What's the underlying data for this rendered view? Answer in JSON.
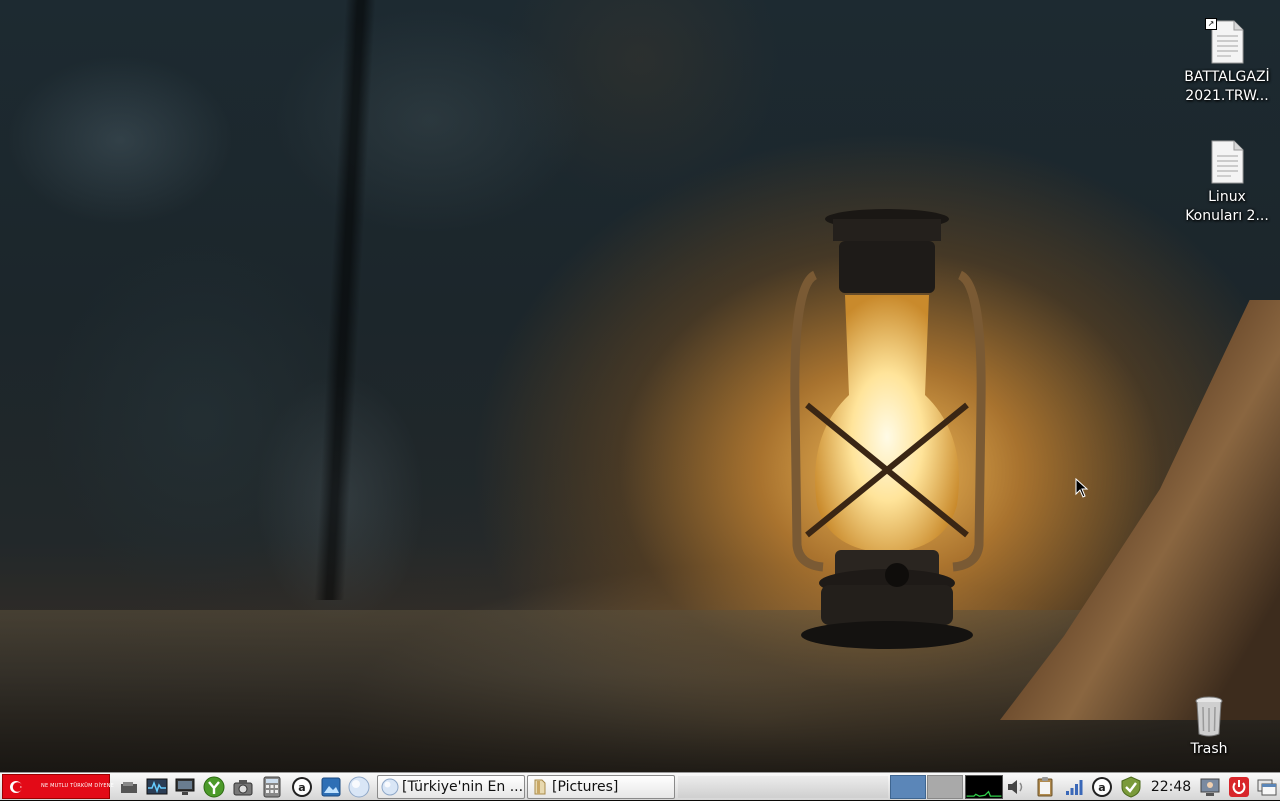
{
  "desktop": {
    "icons": [
      {
        "line1": "BATTALGAZİ",
        "line2": "2021.TRW...",
        "icon": "text-document-shortcut-icon"
      },
      {
        "line1": "Linux",
        "line2": "Konuları 2...",
        "icon": "text-document-icon"
      },
      {
        "line1": "Trash",
        "icon": "trash-icon"
      }
    ]
  },
  "taskbar": {
    "start_slogan": "NE MUTLU TÜRKÜM DİYENE",
    "launchers": [
      "show-desktop-icon",
      "system-monitor-icon",
      "display-icon",
      "torrent-client-icon",
      "screenshot-icon",
      "calculator-icon",
      "app-store-icon",
      "image-viewer-icon",
      "web-browser-icon"
    ],
    "tasks": [
      {
        "label": "[Türkiye'nin En ...",
        "icon": "web-browser-icon"
      },
      {
        "label": "[Pictures]",
        "icon": "folder-icon"
      }
    ],
    "tray": [
      "volume-icon",
      "clipboard-icon",
      "network-signal-icon",
      "software-update-icon",
      "security-shield-icon"
    ],
    "clock": "22:48",
    "tray_right": [
      "user-switch-icon",
      "power-icon",
      "window-list-icon"
    ]
  },
  "colors": {
    "start_red": "#e30a17",
    "workspace_active": "#5b86b8",
    "workspace_inactive": "#a9a9a9"
  }
}
